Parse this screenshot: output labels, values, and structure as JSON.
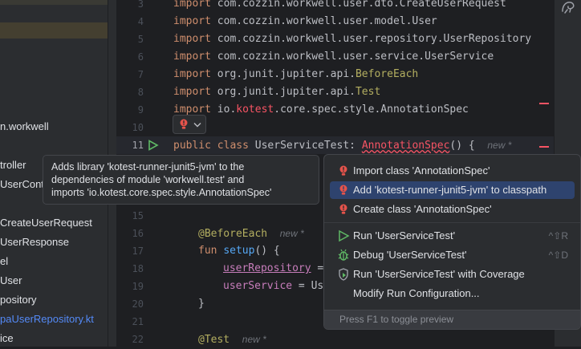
{
  "sidebar": {
    "items": [
      {
        "label": "n.workwell",
        "highlight": false
      },
      {
        "label": "troller",
        "highlight": false
      },
      {
        "label": "UserCont",
        "highlight": false
      },
      {
        "label": "CreateUserRequest",
        "highlight": false
      },
      {
        "label": "UserResponse",
        "highlight": false
      },
      {
        "label": "el",
        "highlight": false
      },
      {
        "label": "User",
        "highlight": false
      },
      {
        "label": "pository",
        "highlight": false
      },
      {
        "label": "paUserRepository.kt",
        "highlight": true
      },
      {
        "label": "ice",
        "highlight": false
      }
    ]
  },
  "editor": {
    "line_numbers": [
      "3",
      "4",
      "5",
      "6",
      "7",
      "8",
      "9",
      "10",
      "11",
      "",
      "",
      "",
      "",
      "15",
      "16",
      "17",
      "18",
      "19",
      "20",
      "21",
      "22"
    ],
    "imports": [
      {
        "kw": "import",
        "path": "com.cozzin.workwell.user.dto.CreateUserRequest"
      },
      {
        "kw": "import",
        "path": "com.cozzin.workwell.user.model.User"
      },
      {
        "kw": "import",
        "path": "com.cozzin.workwell.user.repository.UserRepository"
      },
      {
        "kw": "import",
        "path": "com.cozzin.workwell.user.service.UserService"
      },
      {
        "kw": "import",
        "path_prefix": "org.junit.jupiter.api.",
        "path_item": "BeforeEach"
      },
      {
        "kw": "import",
        "path_prefix": "org.junit.jupiter.api.",
        "path_item": "Test"
      },
      {
        "kw": "import",
        "path_prefix": "io.",
        "path_err": "kotest",
        "path_suffix": ".core.spec.style.AnnotationSpec"
      }
    ],
    "class_line": {
      "kw1": "public",
      "kw2": "class",
      "name": "UserServiceTest",
      "colon": ":",
      "parent": "AnnotationSpec",
      "rest": "() {",
      "hint": "new *"
    },
    "before_each": {
      "annotation": "@BeforeEach",
      "hint": "new *"
    },
    "setup_line": {
      "kw": "fun",
      "name": "setup",
      "rest": "() {"
    },
    "assign1": {
      "prop": "userRepository",
      "rest": " ="
    },
    "assign2": {
      "prop": "userService",
      "rest": " = Us"
    },
    "close_brace": "}",
    "test_line": {
      "annotation": "@Test",
      "hint": "new *"
    }
  },
  "tooltip": {
    "lines": [
      "Adds library 'kotest-runner-junit5-jvm' to the",
      "dependencies of module 'workwell.test' and",
      "imports 'io.kotest.core.spec.style.AnnotationSpec'"
    ]
  },
  "popup": {
    "actions": [
      {
        "label": "Import class 'AnnotationSpec'",
        "icon": "bulb-error-icon"
      },
      {
        "label": "Add 'kotest-runner-junit5-jvm' to classpath",
        "icon": "bulb-error-icon",
        "selected": true
      },
      {
        "label": "Create class 'AnnotationSpec'",
        "icon": "bulb-error-icon"
      }
    ],
    "run_actions": [
      {
        "label": "Run 'UserServiceTest'",
        "icon": "run-icon",
        "shortcut": "^⇧R"
      },
      {
        "label": "Debug 'UserServiceTest'",
        "icon": "debug-icon",
        "shortcut": "^⇧D"
      },
      {
        "label": "Run 'UserServiceTest' with Coverage",
        "icon": "coverage-icon",
        "shortcut": ""
      },
      {
        "label": "Modify Run Configuration...",
        "icon": "",
        "shortcut": ""
      }
    ],
    "footer": "Press F1 to toggle preview"
  },
  "colors": {
    "accent": "#2e436e",
    "error": "#f75464",
    "keyword": "#cf8e6d",
    "annotation": "#b3ae60",
    "function": "#56a8f5",
    "property": "#c77dbb"
  }
}
